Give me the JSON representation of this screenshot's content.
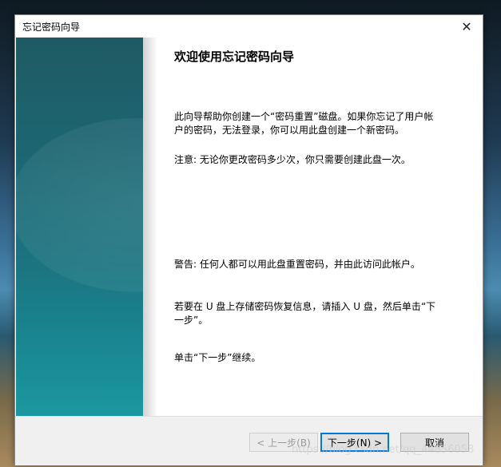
{
  "window": {
    "title": "忘记密码向导",
    "close_glyph": "✕"
  },
  "content": {
    "heading": "欢迎使用忘记密码向导",
    "paragraph1": "此向导帮助你创建一个“密码重置”磁盘。如果你忘记了用户帐户的密码，无法登录，你可以用此盘创建一个新密码。",
    "paragraph2": "注意: 无论你更改密码多少次，你只需要创建此盘一次。",
    "paragraph3": "警告: 任何人都可以用此盘重置密码，并由此访问此帐户。",
    "paragraph4": "若要在 U 盘上存储密码恢复信息，请插入 U 盘，然后单击“下一步”。",
    "paragraph5": "单击“下一步”继续。"
  },
  "buttons": {
    "back": "< 上一步(B)",
    "next": "下一步(N) >",
    "cancel": "取消"
  },
  "watermark": "https://blog.csdn.net/qq_44856058"
}
